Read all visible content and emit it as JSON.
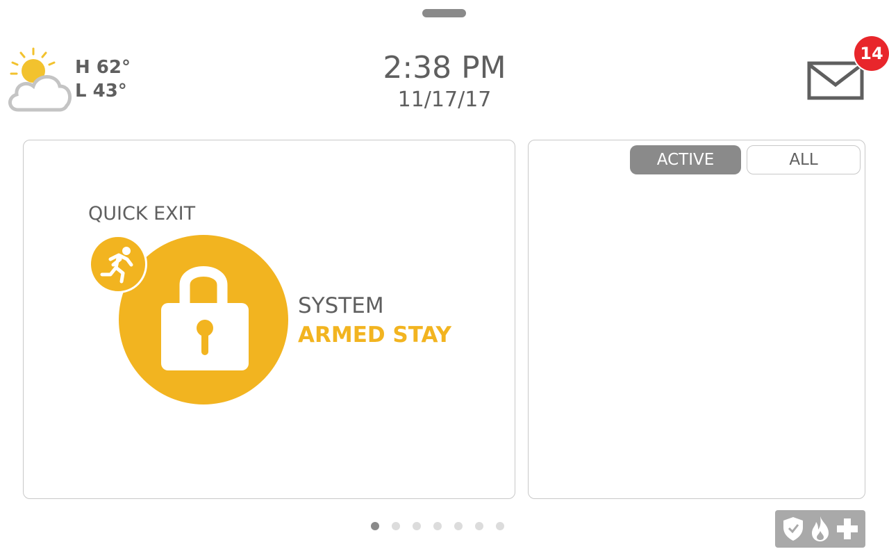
{
  "weather": {
    "icon": "partly-cloudy-icon",
    "high": "H 62°",
    "low": "L 43°"
  },
  "clock": {
    "time": "2:38 PM",
    "date": "11/17/17"
  },
  "messages": {
    "icon": "mail-icon",
    "unread_count": "14"
  },
  "security_panel": {
    "quick_exit_label": "QUICK EXIT",
    "quick_exit_icon": "running-person-icon",
    "lock_icon": "padlock-icon",
    "status_line1": "SYSTEM",
    "status_line2": "ARMED STAY"
  },
  "alerts_panel": {
    "tabs": [
      {
        "label": "ACTIVE",
        "selected": true
      },
      {
        "label": "ALL",
        "selected": false
      }
    ]
  },
  "pager": {
    "total_pages": 7,
    "current_page": 1
  },
  "emergency": {
    "icons": [
      "shield-icon",
      "flame-icon",
      "medical-cross-icon"
    ]
  },
  "colors": {
    "accent": "#f2b420",
    "text": "#5f5f5f",
    "badge": "#e8262b",
    "tab_active": "#8a8a8a",
    "border": "#c8c8c8",
    "emergency_bg": "#a9a9a9"
  }
}
